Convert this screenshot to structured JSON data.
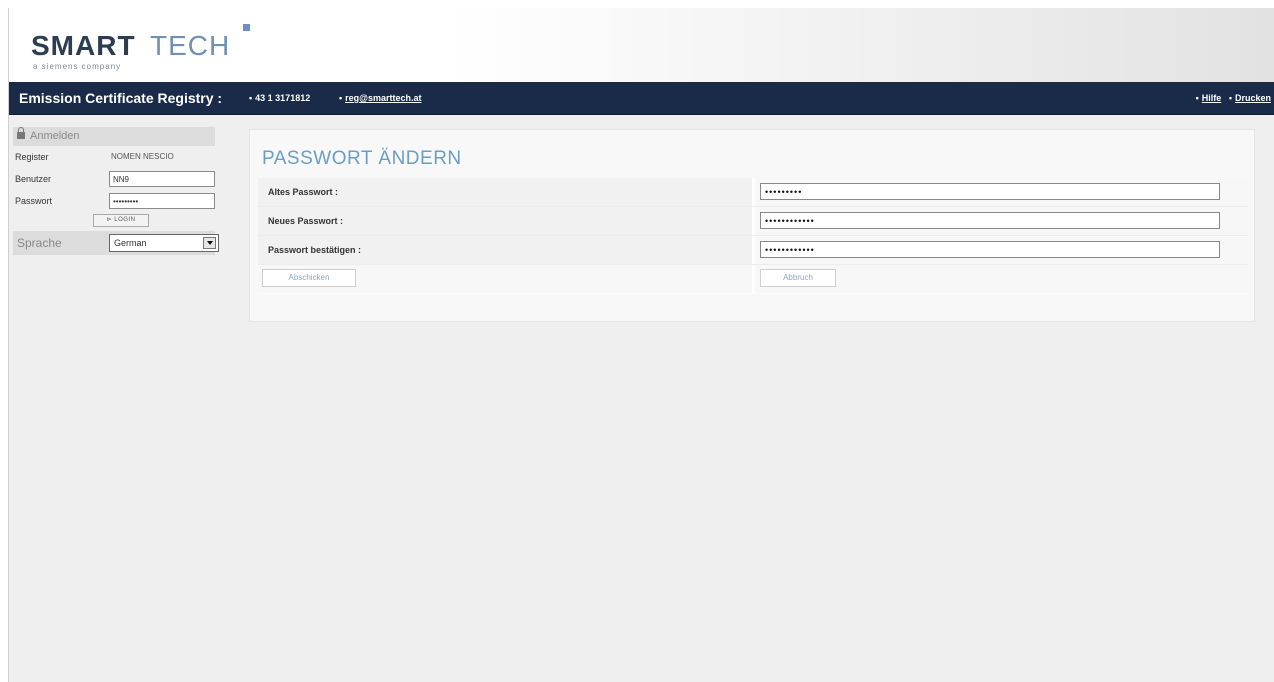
{
  "header": {
    "logo_smart": "SMART",
    "logo_tech": "TECH",
    "logo_sub": "a siemens company"
  },
  "navbar": {
    "title": "Emission Certificate Registry :",
    "phone": "43 1 3171812",
    "email": "reg@smarttech.at",
    "links": [
      "Hilfe",
      "Drucken"
    ]
  },
  "sidebar": {
    "login_title": "Anmelden",
    "register_label": "Register",
    "register_value": "NOMEN NESCIO",
    "user_label": "Benutzer",
    "user_value": "NN9",
    "password_label": "Passwort",
    "password_value": "•••••••••",
    "login_button": "LOGIN",
    "language_label": "Sprache",
    "language_selected": "German"
  },
  "main": {
    "title": "PASSWORT ÄNDERN",
    "fields": [
      {
        "label": "Altes Passwort :",
        "value": "•••••••••"
      },
      {
        "label": "Neues Passwort :",
        "value": "••••••••••••"
      },
      {
        "label": "Passwort bestätigen :",
        "value": "••••••••••••"
      }
    ],
    "submit_button": "Abschicken",
    "cancel_button": "Abbruch"
  },
  "colors": {
    "navbar_bg": "#1a2b49",
    "title_accent": "#6b9dc5",
    "logo_dark": "#2c3d52",
    "logo_light": "#6f8fb3"
  }
}
